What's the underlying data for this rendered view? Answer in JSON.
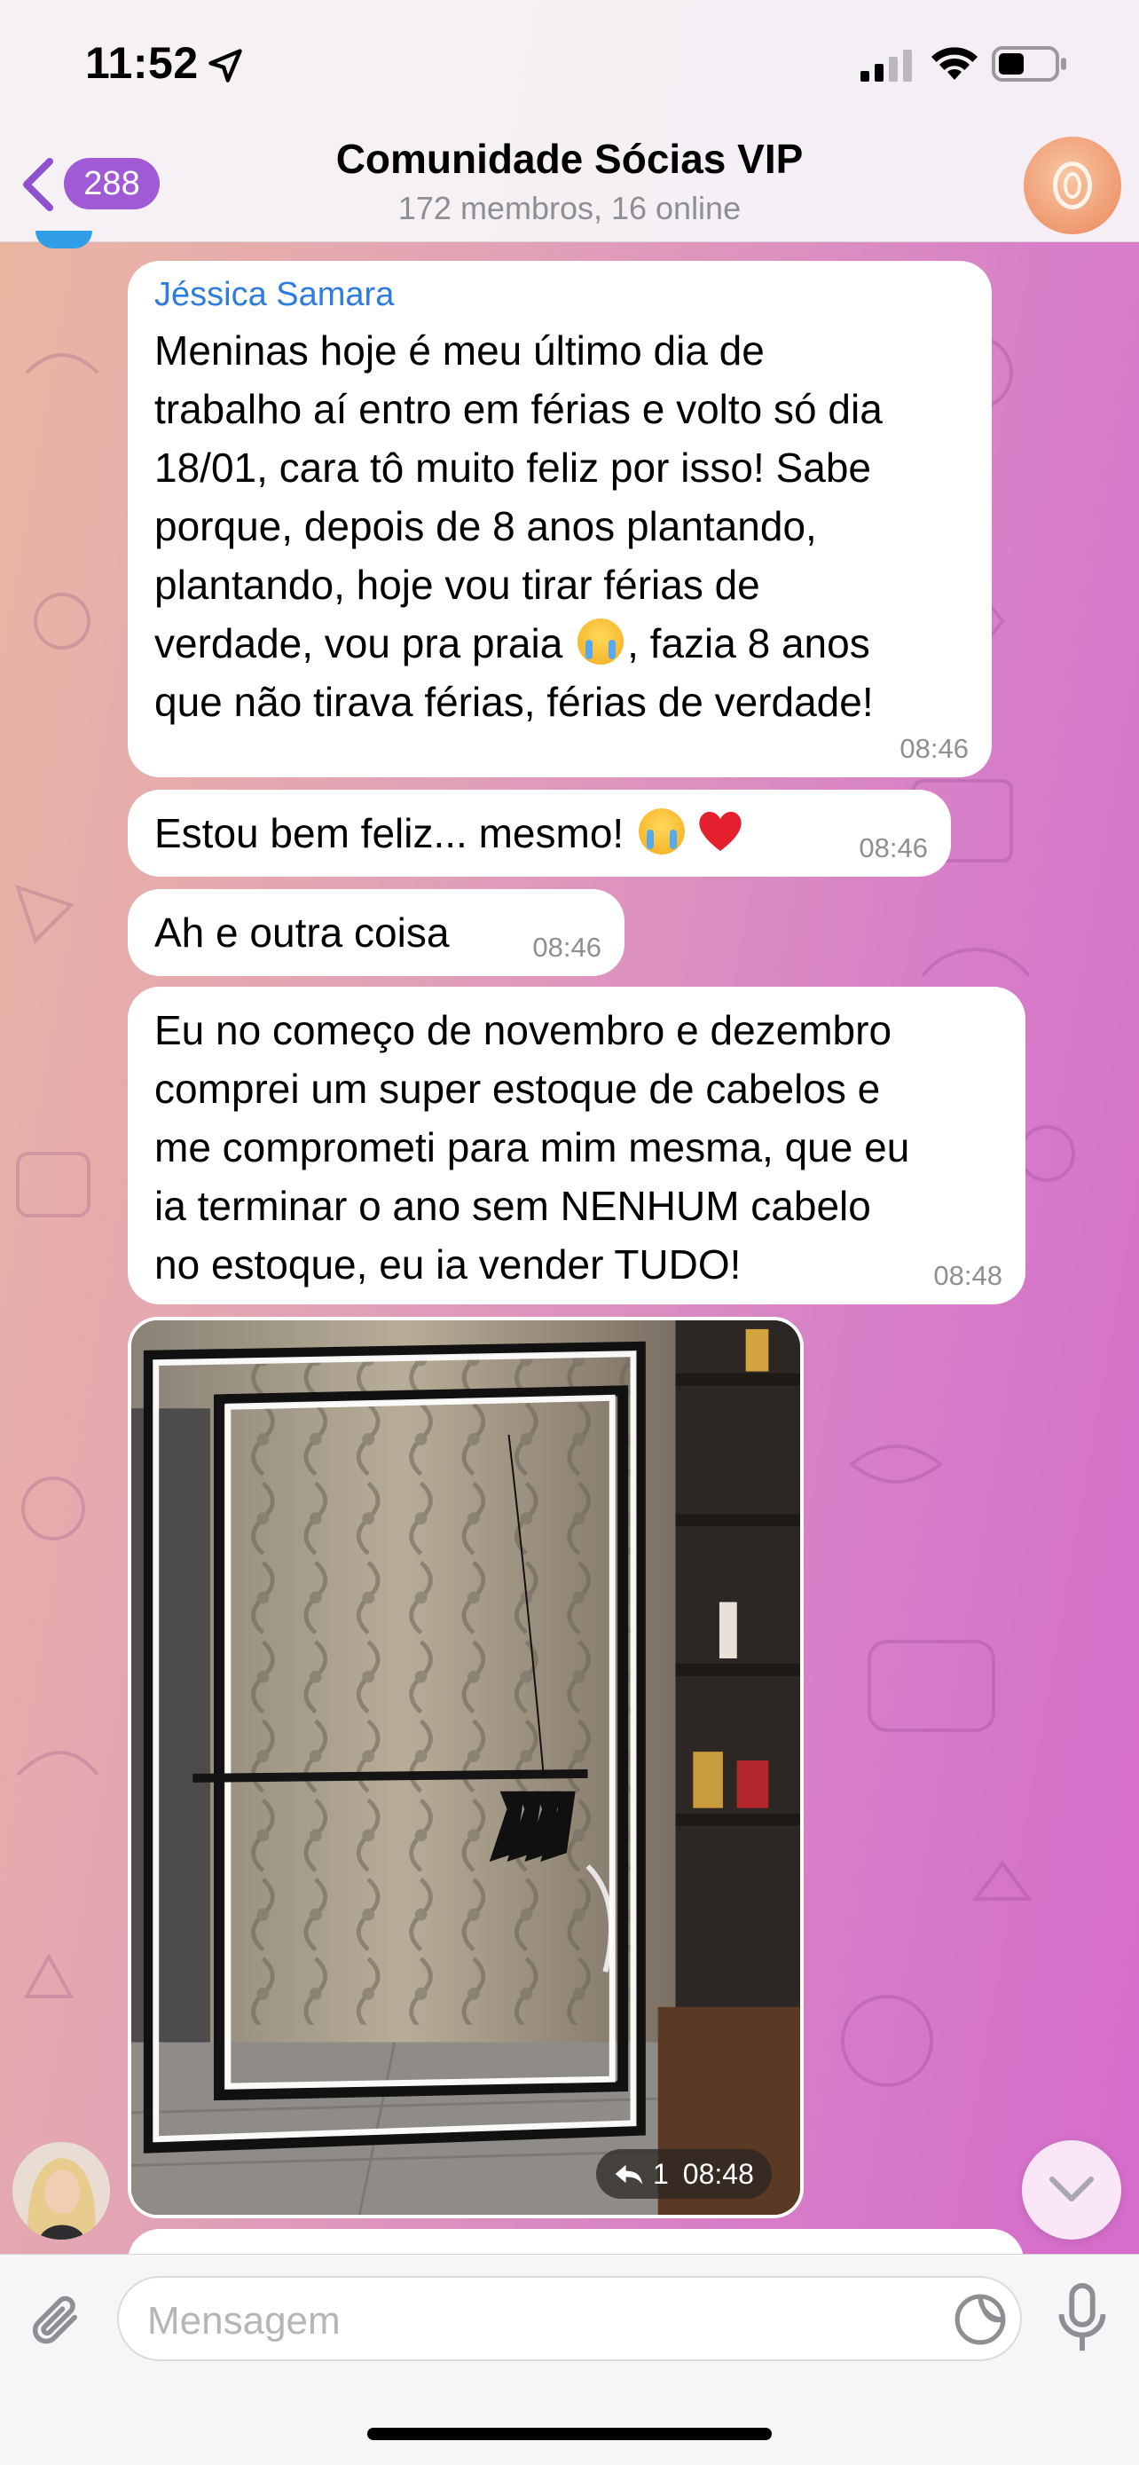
{
  "status_bar": {
    "time": "11:52"
  },
  "header": {
    "back_count": "288",
    "title": "Comunidade Sócias VIP",
    "subtitle": "172 membros, 16 online"
  },
  "messages": [
    {
      "sender": "Jéssica Samara",
      "text_a": "Meninas hoje é meu último dia de\ntrabalho aí entro em férias e volto só dia\n18/01, cara tô muito feliz por isso! Sabe\nporque, depois de 8 anos plantando,\nplantando, hoje vou tirar férias de\nverdade, vou pra praia ",
      "text_b": ", fazia 8 anos\nque não tirava férias, férias de verdade!",
      "time": "08:46"
    },
    {
      "text": "Estou bem feliz... mesmo! ",
      "time": "08:46"
    },
    {
      "text": "Ah e outra coisa",
      "time": "08:46"
    },
    {
      "text": "Eu no começo de novembro e dezembro\ncomprei um super estoque de cabelos e\nme comprometi para mim mesma, que eu\nia terminar o ano sem NENHUM cabelo\nno estoque, eu ia vender TUDO!",
      "time": "08:48"
    }
  ],
  "photo_message": {
    "reply_count": "1",
    "time": "08:48"
  },
  "input": {
    "placeholder": "Mensagem"
  },
  "colors": {
    "badge": "#a05ad6",
    "sender_name": "#2f7ce0",
    "accent_back": "#8e52d1"
  },
  "icons": [
    "location-arrow-icon",
    "signal-icon",
    "wifi-icon",
    "battery-icon",
    "chevron-left-icon",
    "reply-icon",
    "chevron-down-icon",
    "paperclip-icon",
    "sticker-icon",
    "microphone-icon"
  ]
}
